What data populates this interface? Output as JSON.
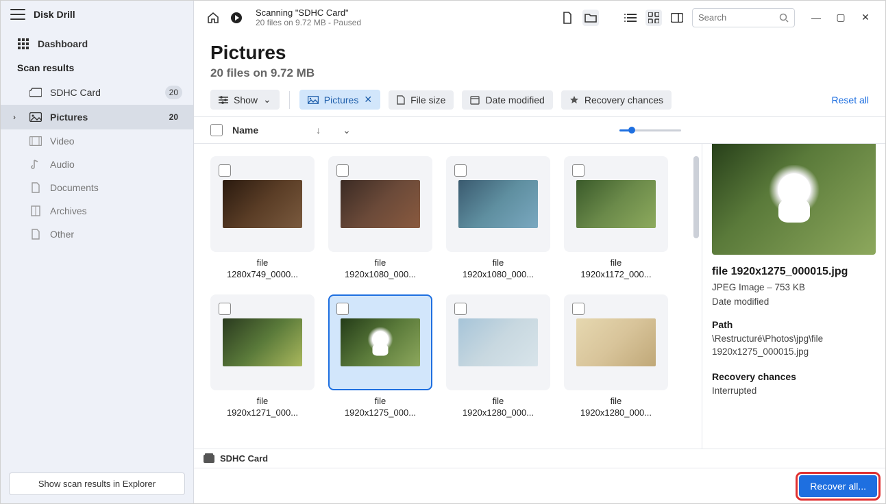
{
  "app": {
    "title": "Disk Drill"
  },
  "sidebar": {
    "dashboard": "Dashboard",
    "scan_results_label": "Scan results",
    "items": [
      {
        "label": "SDHC Card",
        "badge": "20"
      },
      {
        "label": "Pictures",
        "badge": "20"
      },
      {
        "label": "Video"
      },
      {
        "label": "Audio"
      },
      {
        "label": "Documents"
      },
      {
        "label": "Archives"
      },
      {
        "label": "Other"
      }
    ],
    "explorer_btn": "Show scan results in Explorer"
  },
  "topbar": {
    "scan_title": "Scanning \"SDHC Card\"",
    "scan_sub": "20 files on 9.72 MB - Paused",
    "search_placeholder": "Search"
  },
  "page": {
    "title": "Pictures",
    "subtitle": "20 files on 9.72 MB"
  },
  "filters": {
    "show": "Show",
    "pictures": "Pictures",
    "file_size": "File size",
    "date_modified": "Date modified",
    "recovery_chances": "Recovery chances",
    "reset": "Reset all"
  },
  "list_head": {
    "name": "Name"
  },
  "grid": [
    {
      "line1": "file",
      "line2": "1280x749_0000...",
      "bg": "linear-gradient(135deg,#2a1a0f,#5a3d26,#7a5a3e)"
    },
    {
      "line1": "file",
      "line2": "1920x1080_000...",
      "bg": "linear-gradient(135deg,#3b2b24,#6b4a39,#8a5a3f)"
    },
    {
      "line1": "file",
      "line2": "1920x1080_000...",
      "bg": "linear-gradient(135deg,#3a5a6f,#5f8fa0,#7aa8c0)"
    },
    {
      "line1": "file",
      "line2": "1920x1172_000...",
      "bg": "linear-gradient(135deg,#3a5a2a,#6b8a4a,#8daa5d)"
    },
    {
      "line1": "file",
      "line2": "1920x1271_000...",
      "bg": "linear-gradient(135deg,#2a3a1f,#5a7a3a,#aab85d)"
    },
    {
      "line1": "file",
      "line2": "1920x1275_000...",
      "bg": "linear-gradient(135deg,#243c18,#5a7a3a,#8da85d)",
      "selected": true,
      "puppy": true
    },
    {
      "line1": "file",
      "line2": "1920x1280_000...",
      "bg": "linear-gradient(135deg,#a6c4d8,#c8d8e0,#d8e4ea)"
    },
    {
      "line1": "file",
      "line2": "1920x1280_000...",
      "bg": "linear-gradient(135deg,#e6d8b0,#d8c49a,#c0a878)"
    }
  ],
  "detail": {
    "filename": "file 1920x1275_000015.jpg",
    "type_size": "JPEG Image – 753 KB",
    "date_label": "Date modified",
    "path_label": "Path",
    "path_value": "\\Restructuré\\Photos\\jpg\\file 1920x1275_000015.jpg",
    "recovery_label": "Recovery chances",
    "recovery_value": "Interrupted"
  },
  "status": {
    "disk": "SDHC Card"
  },
  "bottom": {
    "recover": "Recover all..."
  }
}
